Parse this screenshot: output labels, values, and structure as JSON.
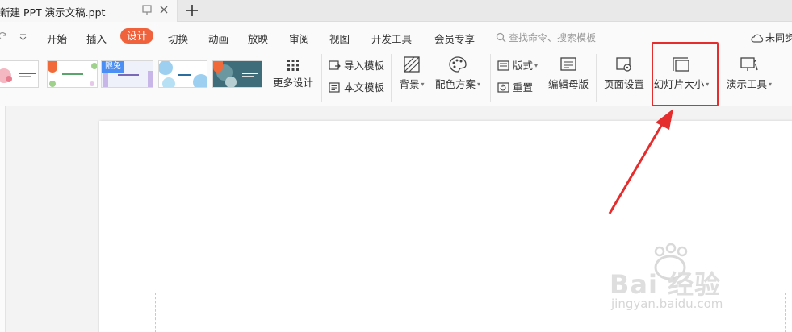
{
  "tab": {
    "title": "新建 PPT 演示文稿.ppt"
  },
  "menu": {
    "items": [
      "开始",
      "插入",
      "设计",
      "切换",
      "动画",
      "放映",
      "审阅",
      "视图",
      "开发工具",
      "会员专享"
    ],
    "active": "设计",
    "search_placeholder": "查找命令、搜索模板",
    "sync_label": "未同步"
  },
  "ribbon": {
    "thumb_tag": "限免",
    "more_design": "更多设计",
    "import_template": "导入模板",
    "text_template": "本文模板",
    "background": "背景",
    "color_scheme": "配色方案",
    "layout": "版式",
    "reset": "重置",
    "edit_master": "编辑母版",
    "page_setup": "页面设置",
    "slide_size": "幻灯片大小",
    "present_tools": "演示工具"
  },
  "watermark": {
    "brand": "Bai 经验",
    "url": "jingyan.baidu.com"
  },
  "colors": {
    "accent": "#f0623b",
    "highlight": "#e52d2d"
  }
}
